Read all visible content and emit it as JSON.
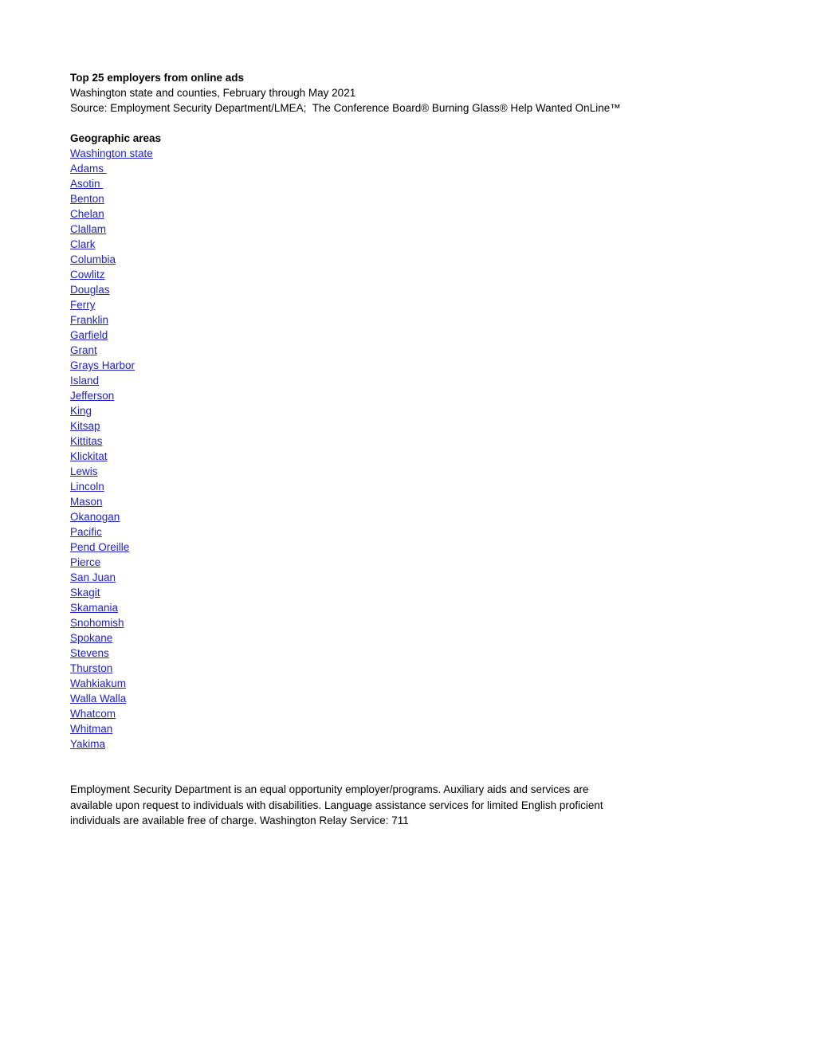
{
  "document": {
    "title_line": "Top 25 employers from online ads",
    "subtitle_line": "Washington state and counties, February through May 2021",
    "source_line": "Source: Employment Security Department/LMEA;  The Conference Board® Burning Glass® Help Wanted OnLine™"
  },
  "geographic_areas": {
    "heading": "Geographic areas",
    "link_color": "#2020CC",
    "items": [
      {
        "label": "Washington state"
      },
      {
        "label": "Adams "
      },
      {
        "label": "Asotin "
      },
      {
        "label": "Benton"
      },
      {
        "label": "Chelan"
      },
      {
        "label": "Clallam"
      },
      {
        "label": "Clark"
      },
      {
        "label": "Columbia"
      },
      {
        "label": "Cowlitz"
      },
      {
        "label": "Douglas"
      },
      {
        "label": "Ferry"
      },
      {
        "label": "Franklin"
      },
      {
        "label": "Garfield"
      },
      {
        "label": "Grant"
      },
      {
        "label": "Grays Harbor"
      },
      {
        "label": "Island"
      },
      {
        "label": "Jefferson"
      },
      {
        "label": "King"
      },
      {
        "label": "Kitsap"
      },
      {
        "label": "Kittitas"
      },
      {
        "label": "Klickitat"
      },
      {
        "label": "Lewis"
      },
      {
        "label": "Lincoln"
      },
      {
        "label": "Mason"
      },
      {
        "label": "Okanogan"
      },
      {
        "label": "Pacific"
      },
      {
        "label": "Pend Oreille"
      },
      {
        "label": "Pierce"
      },
      {
        "label": "San Juan"
      },
      {
        "label": "Skagit"
      },
      {
        "label": "Skamania"
      },
      {
        "label": "Snohomish"
      },
      {
        "label": "Spokane"
      },
      {
        "label": "Stevens"
      },
      {
        "label": "Thurston"
      },
      {
        "label": "Wahkiakum"
      },
      {
        "label": "Walla Walla"
      },
      {
        "label": "Whatcom"
      },
      {
        "label": "Whitman"
      },
      {
        "label": "Yakima"
      }
    ]
  },
  "footer": {
    "notice": "Employment Security Department is an equal opportunity employer/programs. Auxiliary aids and services are available upon request to individuals with disabilities. Language assistance services for limited English proficient individuals are available free of charge. Washington Relay Service: 711"
  }
}
